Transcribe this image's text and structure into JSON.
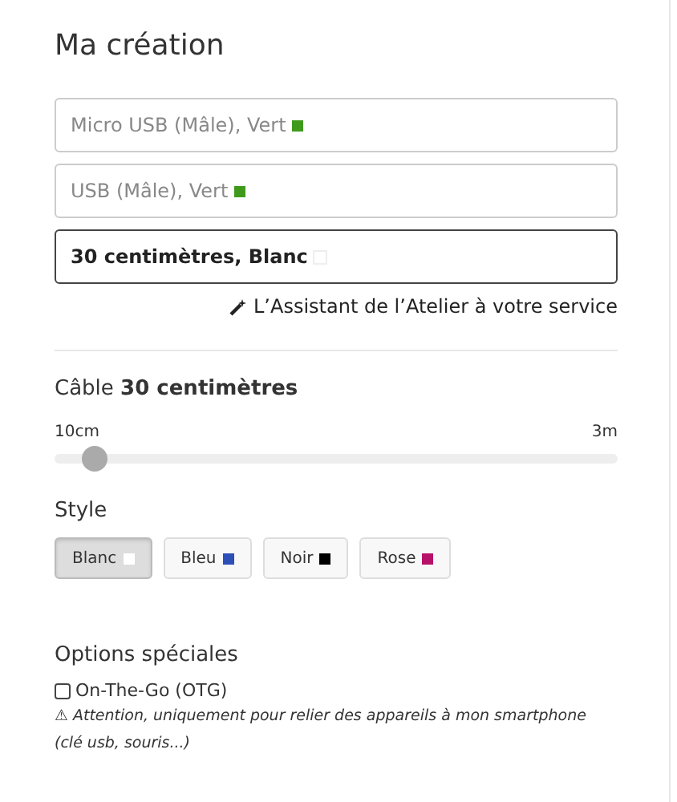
{
  "title": "Ma création",
  "fields": [
    {
      "value": "Micro USB (Mâle), Vert",
      "color": "#3f9a1c",
      "active": false
    },
    {
      "value": "USB (Mâle), Vert",
      "color": "#3f9a1c",
      "active": false
    },
    {
      "value": "30 centimètres, Blanc",
      "color": "#ffffff",
      "active": true
    }
  ],
  "assistant_link": "L’Assistant de l’Atelier à votre service",
  "length": {
    "label": "Câble **30 centimètres**",
    "min": "10cm",
    "max": "3m",
    "level": 0.07
  },
  "style": {
    "label": "Style",
    "options": [
      {
        "label": "Blanc",
        "color": "#ffffff",
        "selected": true
      },
      {
        "label": "Bleu",
        "color": "#2c4fb8",
        "selected": false
      },
      {
        "label": "Noir",
        "color": "#000000",
        "selected": false
      },
      {
        "label": "Rose",
        "color": "#b8116a",
        "selected": false
      }
    ]
  },
  "special": {
    "title": "Options spéciales",
    "items": [
      {
        "label": "On-The-Go (OTG)",
        "checked": false,
        "note": "⚠ Attention, uniquement pour relier des appareils à mon smartphone (clé usb, souris...)"
      }
    ]
  }
}
